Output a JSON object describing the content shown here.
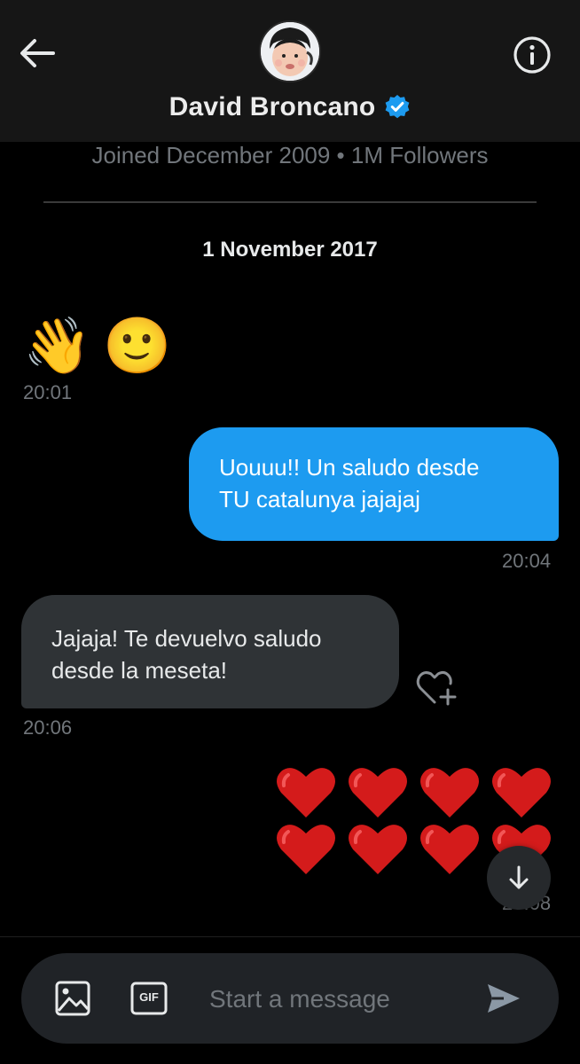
{
  "header": {
    "name": "David Broncano",
    "verified": true,
    "meta": "Joined December 2009 • 1M Followers",
    "back_icon": "arrow-left-icon",
    "info_icon": "info-icon"
  },
  "date_separator": "1 November 2017",
  "messages": [
    {
      "direction": "incoming",
      "type": "emoji",
      "content": [
        "👋",
        "🙂"
      ],
      "time": "20:01"
    },
    {
      "direction": "outgoing",
      "type": "text",
      "lines": [
        "Uouuu!! Un saludo desde",
        "TU catalunya jajajaj"
      ],
      "time": "20:04"
    },
    {
      "direction": "incoming",
      "type": "text",
      "lines": [
        "Jajaja! Te devuelvo saludo",
        "desde la meseta!"
      ],
      "time": "20:06"
    },
    {
      "direction": "outgoing",
      "type": "emoji",
      "content": [
        "❤️",
        "❤️",
        "❤️",
        "❤️",
        "❤️",
        "❤️",
        "❤️",
        "❤️"
      ],
      "time": "20:08"
    }
  ],
  "composer": {
    "placeholder": "Start a message",
    "gif_label": "GIF"
  },
  "colors": {
    "accent": "#1d9bf0",
    "background": "#000000",
    "header_bg": "#161616",
    "incoming_bubble": "#2f3336",
    "muted_text": "#71767b",
    "heart": "#d41b1b"
  }
}
